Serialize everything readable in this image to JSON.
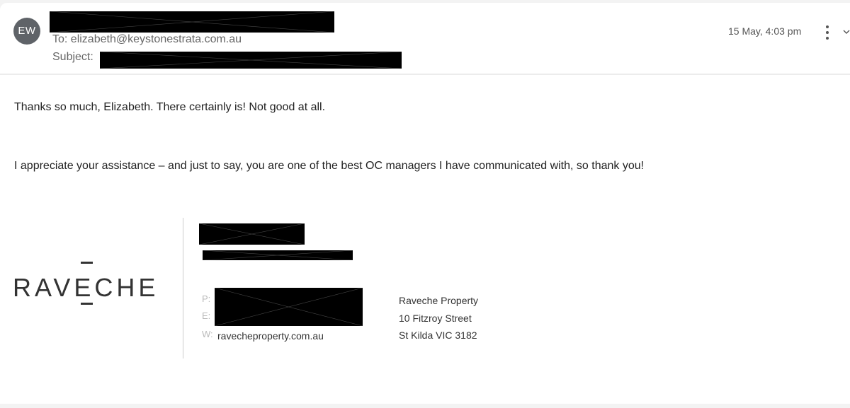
{
  "sender": {
    "avatar_initials": "EW"
  },
  "email": {
    "to_line": "To: elizabeth@keystonestrata.com.au",
    "subject_label": "Subject:",
    "date": "15 May, 4:03 pm"
  },
  "body": {
    "paragraph_1": "Thanks so much, Elizabeth. There certainly is! Not good at all.",
    "paragraph_2": "I appreciate your assistance – and just to say, you are one of the best OC managers I have communicated with, so thank you!"
  },
  "signature": {
    "logo_text": "RAVECHE",
    "phone_label": "P:",
    "email_label": "E:",
    "web_label": "W:",
    "website": "ravecheproperty.com.au",
    "address": {
      "company": "Raveche Property",
      "street": "10 Fitzroy Street",
      "city": "St Kilda VIC 3182"
    }
  },
  "icons": {
    "more": "more-vertical-icon",
    "expand": "chevron-down-icon"
  }
}
